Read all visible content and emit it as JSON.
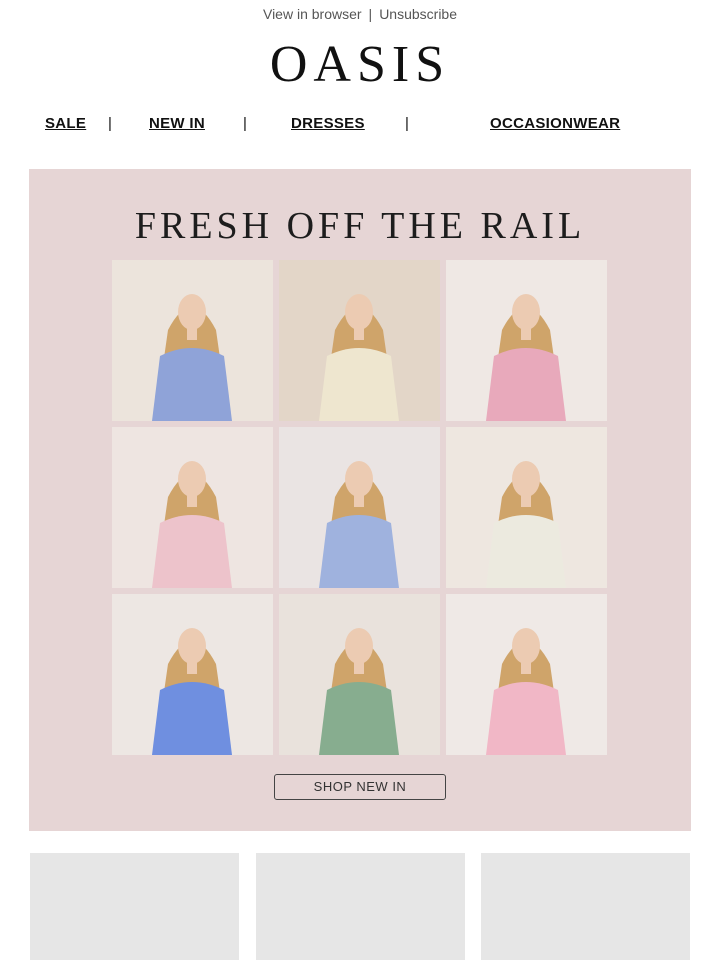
{
  "top_links": {
    "view_in_browser": "View in browser",
    "separator": "|",
    "unsubscribe": "Unsubscribe"
  },
  "logo": {
    "text": "OASIS"
  },
  "nav": {
    "items": [
      {
        "label": "SALE"
      },
      {
        "label": "NEW IN"
      },
      {
        "label": "DRESSES"
      },
      {
        "label": "OCCASIONWEAR"
      }
    ],
    "separator": "|"
  },
  "hero": {
    "title": "FRESH OFF THE RAIL",
    "background": "#e6d5d5",
    "cta_label": "SHOP NEW IN",
    "photos": [
      {
        "subject": "woman in blue halter satin dress",
        "outfit_color": "#8fa3d8"
      },
      {
        "subject": "woman in cream blazer and satin slip",
        "outfit_color": "#eee6cf"
      },
      {
        "subject": "woman in pink floral puff-sleeve dress",
        "outfit_color": "#e8a9bb"
      },
      {
        "subject": "woman in pink tailored blazer",
        "outfit_color": "#edc3cb"
      },
      {
        "subject": "woman in blue floral blouse",
        "outfit_color": "#9fb2de"
      },
      {
        "subject": "woman in white floral halter dress",
        "outfit_color": "#eceadf"
      },
      {
        "subject": "woman in blue lace dress",
        "outfit_color": "#6f8fe0"
      },
      {
        "subject": "woman in green floral dress",
        "outfit_color": "#87ad8f"
      },
      {
        "subject": "woman in pink rose print dress",
        "outfit_color": "#f1b7c6"
      }
    ]
  },
  "placeholders_color": "#e6e6e6"
}
